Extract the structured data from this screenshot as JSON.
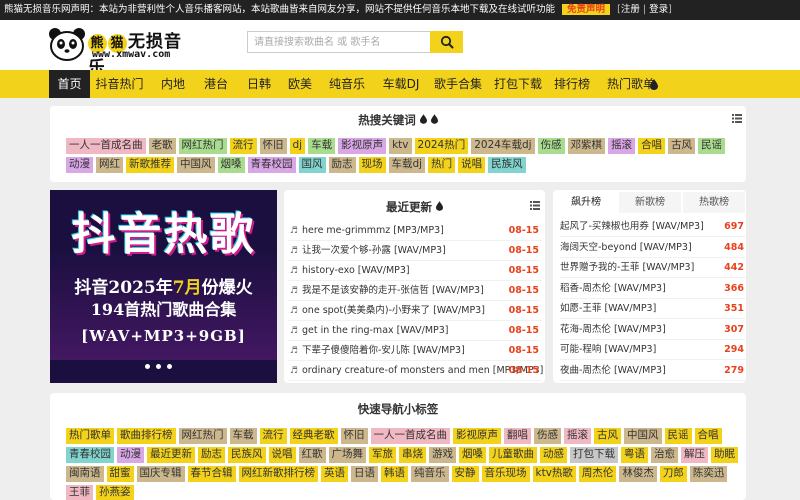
{
  "topbar": {
    "notice": "熊猫无损音乐网声明：本站为非营利性个人音乐播客网站，本站歌曲皆来自网友分享，网站不提供任何音乐本地下载及在线试听功能",
    "disclaimer": "免责声明",
    "register": "注册",
    "login": "登录",
    "bracket_open": "[",
    "divider": "|",
    "bracket_close": "]"
  },
  "logo": {
    "name_chars": [
      "熊",
      "猫"
    ],
    "name_rest": "无损音乐",
    "url": "www.xmwav.com"
  },
  "search": {
    "placeholder": "请直接搜索歌曲名 或 歌手名"
  },
  "nav": [
    {
      "label": "首页",
      "active": true
    },
    {
      "label": "抖音热门"
    },
    {
      "label": "内地"
    },
    {
      "label": "港台"
    },
    {
      "label": "日韩"
    },
    {
      "label": "欧美"
    },
    {
      "label": "纯音乐"
    },
    {
      "label": "车载DJ"
    },
    {
      "label": "歌手合集"
    },
    {
      "label": "打包下载"
    },
    {
      "label": "排行榜"
    },
    {
      "label": "热门歌单"
    }
  ],
  "hot_keywords": {
    "title": "热搜关键词",
    "tags": [
      {
        "label": "一人一首成名曲",
        "color": "pink"
      },
      {
        "label": "老歌",
        "color": "tan"
      },
      {
        "label": "网红热门",
        "color": "green"
      },
      {
        "label": "流行",
        "color": "yellow"
      },
      {
        "label": "怀旧",
        "color": "tan"
      },
      {
        "label": "dj",
        "color": "yellow"
      },
      {
        "label": "车载",
        "color": "green"
      },
      {
        "label": "影视原声",
        "color": "lav"
      },
      {
        "label": "ktv",
        "color": "tan"
      },
      {
        "label": "2024热门",
        "color": "yellow"
      },
      {
        "label": "2024车载dj",
        "color": "tan"
      },
      {
        "label": "伤感",
        "color": "green"
      },
      {
        "label": "邓紫棋",
        "color": "tan"
      },
      {
        "label": "摇滚",
        "color": "lav"
      },
      {
        "label": "合唱",
        "color": "yellow"
      },
      {
        "label": "古风",
        "color": "tan"
      },
      {
        "label": "民谣",
        "color": "green"
      },
      {
        "label": "动漫",
        "color": "lav"
      },
      {
        "label": "网红",
        "color": "tan"
      },
      {
        "label": "新歌推荐",
        "color": "yellow"
      },
      {
        "label": "中国风",
        "color": "tan"
      },
      {
        "label": "烟嗓",
        "color": "green"
      },
      {
        "label": "青春校园",
        "color": "lav"
      },
      {
        "label": "国风",
        "color": "teal"
      },
      {
        "label": "励志",
        "color": "tan"
      },
      {
        "label": "现场",
        "color": "yellow"
      },
      {
        "label": "车载dj",
        "color": "tan"
      },
      {
        "label": "热门",
        "color": "yellow"
      },
      {
        "label": "说唱",
        "color": "yellow"
      },
      {
        "label": "民族风",
        "color": "teal"
      }
    ]
  },
  "slider": {
    "headline": "抖音热歌",
    "line1_a": "抖音2025年",
    "line1_b": "7月",
    "line1_c": "份爆火",
    "line2": "194首热门歌曲合集",
    "line3": "[WAV+MP3+9GB]"
  },
  "recent": {
    "title": "最近更新",
    "items": [
      {
        "name": "here me-grimmmz [MP3/MP3]",
        "date": "08-15"
      },
      {
        "name": "让我一次爱个够-孙露 [WAV/MP3]",
        "date": "08-15"
      },
      {
        "name": "history-exo [WAV/MP3]",
        "date": "08-15"
      },
      {
        "name": "我是不是该安静的走开-张信哲 [WAV/MP3]",
        "date": "08-15"
      },
      {
        "name": "one spot(美美桑内)-小野来了 [WAV/MP3]",
        "date": "08-15"
      },
      {
        "name": "get in the ring-max [WAV/MP3]",
        "date": "08-15"
      },
      {
        "name": "下辈子傻傻陪着你-安儿陈 [WAV/MP3]",
        "date": "08-15"
      },
      {
        "name": "ordinary creature-of monsters and men [MP3/MP3]",
        "date": "08-15"
      }
    ]
  },
  "rank": {
    "tabs": [
      {
        "label": "飙升榜",
        "active": true
      },
      {
        "label": "新歌榜"
      },
      {
        "label": "热歌榜"
      }
    ],
    "items": [
      {
        "name": "起风了-买辣椒也用券 [WAV/MP3]",
        "count": "697"
      },
      {
        "name": "海阔天空-beyond [WAV/MP3]",
        "count": "484"
      },
      {
        "name": "世界赠予我的-王菲 [WAV/MP3]",
        "count": "442"
      },
      {
        "name": "稻香-周杰伦 [WAV/MP3]",
        "count": "366"
      },
      {
        "name": "如愿-王菲 [WAV/MP3]",
        "count": "351"
      },
      {
        "name": "花海-周杰伦 [WAV/MP3]",
        "count": "307"
      },
      {
        "name": "可能-程响 [WAV/MP3]",
        "count": "294"
      },
      {
        "name": "夜曲-周杰伦 [WAV/MP3]",
        "count": "279"
      }
    ]
  },
  "quick_nav": {
    "title": "快速导航小标签",
    "tags": [
      {
        "label": "热门歌单",
        "color": "yellow"
      },
      {
        "label": "歌曲排行榜",
        "color": "yellow"
      },
      {
        "label": "网红热门",
        "color": "tan"
      },
      {
        "label": "车载",
        "color": "tan"
      },
      {
        "label": "流行",
        "color": "yellow"
      },
      {
        "label": "经典老歌",
        "color": "yellow"
      },
      {
        "label": "怀旧",
        "color": "tan"
      },
      {
        "label": "一人一首成名曲",
        "color": "pink"
      },
      {
        "label": "影视原声",
        "color": "yellow"
      },
      {
        "label": "翻唱",
        "color": "pink"
      },
      {
        "label": "伤感",
        "color": "tan"
      },
      {
        "label": "摇滚",
        "color": "pink"
      },
      {
        "label": "古风",
        "color": "yellow"
      },
      {
        "label": "中国风",
        "color": "tan"
      },
      {
        "label": "民谣",
        "color": "yellow"
      },
      {
        "label": "合唱",
        "color": "yellow"
      },
      {
        "label": "青春校园",
        "color": "teal"
      },
      {
        "label": "动漫",
        "color": "lav"
      },
      {
        "label": "最近更新",
        "color": "yellow"
      },
      {
        "label": "励志",
        "color": "yellow"
      },
      {
        "label": "民族风",
        "color": "yellow"
      },
      {
        "label": "说唱",
        "color": "yellow"
      },
      {
        "label": "红歌",
        "color": "tan"
      },
      {
        "label": "广场舞",
        "color": "tan"
      },
      {
        "label": "军旅",
        "color": "yellow"
      },
      {
        "label": "串烧",
        "color": "yellow"
      },
      {
        "label": "游戏",
        "color": "tan"
      },
      {
        "label": "烟嗓",
        "color": "yellow"
      },
      {
        "label": "儿童歌曲",
        "color": "yellow"
      },
      {
        "label": "动感",
        "color": "yellow"
      },
      {
        "label": "打包下载",
        "color": "grey"
      },
      {
        "label": "粤语",
        "color": "yellow"
      },
      {
        "label": "治愈",
        "color": "tan"
      },
      {
        "label": "解压",
        "color": "pink"
      },
      {
        "label": "助眠",
        "color": "yellow"
      },
      {
        "label": "闽南语",
        "color": "tan"
      },
      {
        "label": "甜蜜",
        "color": "yellow"
      },
      {
        "label": "国庆专辑",
        "color": "tan"
      },
      {
        "label": "春节合辑",
        "color": "yellow"
      },
      {
        "label": "网红新歌排行榜",
        "color": "yellow"
      },
      {
        "label": "英语",
        "color": "yellow"
      },
      {
        "label": "日语",
        "color": "tan"
      },
      {
        "label": "韩语",
        "color": "yellow"
      },
      {
        "label": "纯音乐",
        "color": "tan"
      },
      {
        "label": "安静",
        "color": "yellow"
      },
      {
        "label": "音乐现场",
        "color": "yellow"
      },
      {
        "label": "ktv热歌",
        "color": "yellow"
      },
      {
        "label": "周杰伦",
        "color": "yellow"
      },
      {
        "label": "林俊杰",
        "color": "tan"
      },
      {
        "label": "刀郎",
        "color": "yellow"
      },
      {
        "label": "陈奕迅",
        "color": "tan"
      },
      {
        "label": "王菲",
        "color": "pink"
      },
      {
        "label": "孙燕姿",
        "color": "yellow"
      }
    ]
  }
}
